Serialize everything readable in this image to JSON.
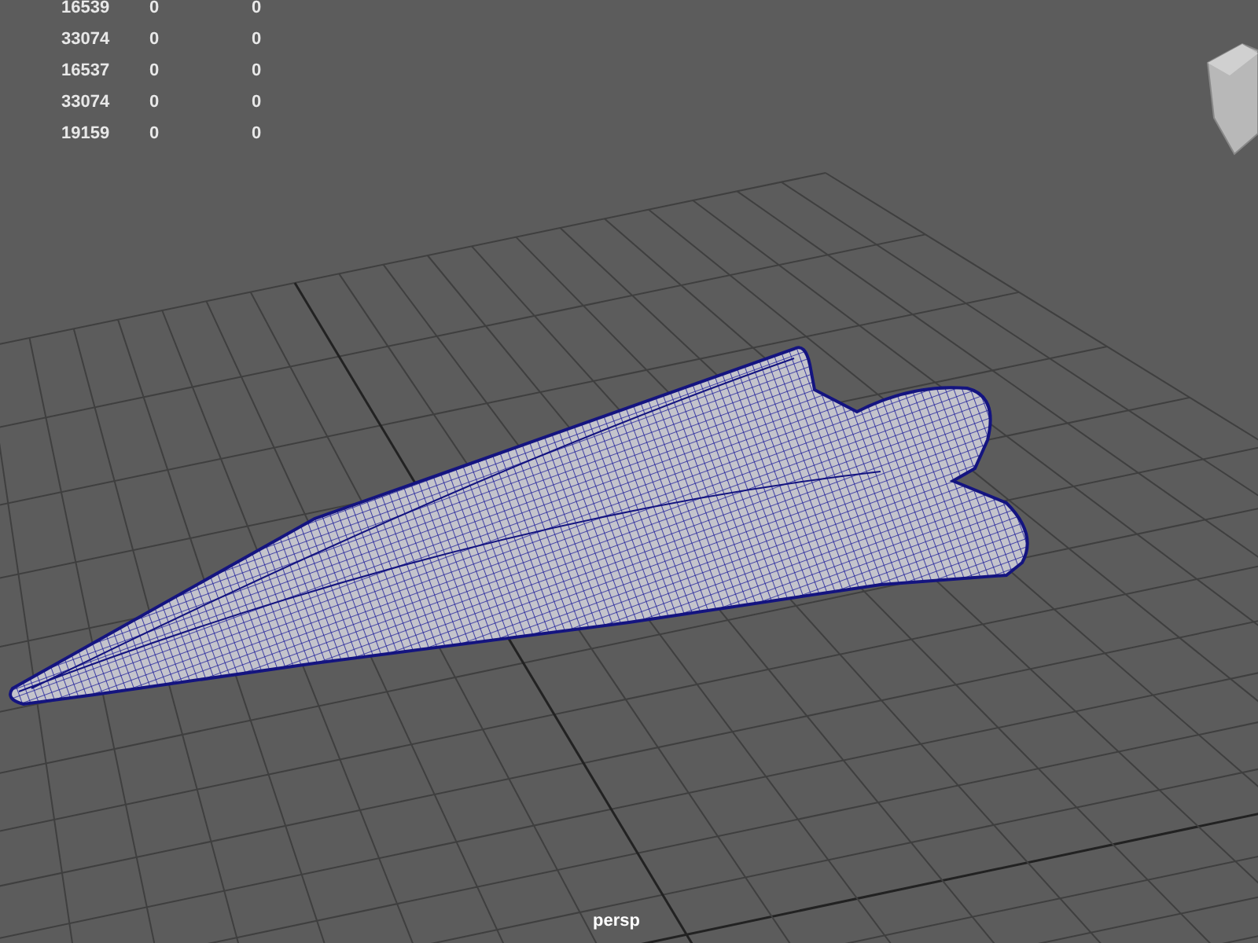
{
  "stats": [
    {
      "values": [
        "16539",
        "0",
        "0"
      ]
    },
    {
      "values": [
        "33074",
        "0",
        "0"
      ]
    },
    {
      "values": [
        "16537",
        "0",
        "0"
      ]
    },
    {
      "values": [
        "33074",
        "0",
        "0"
      ]
    },
    {
      "values": [
        "19159",
        "0",
        "0"
      ]
    }
  ],
  "camera_label": "persp"
}
